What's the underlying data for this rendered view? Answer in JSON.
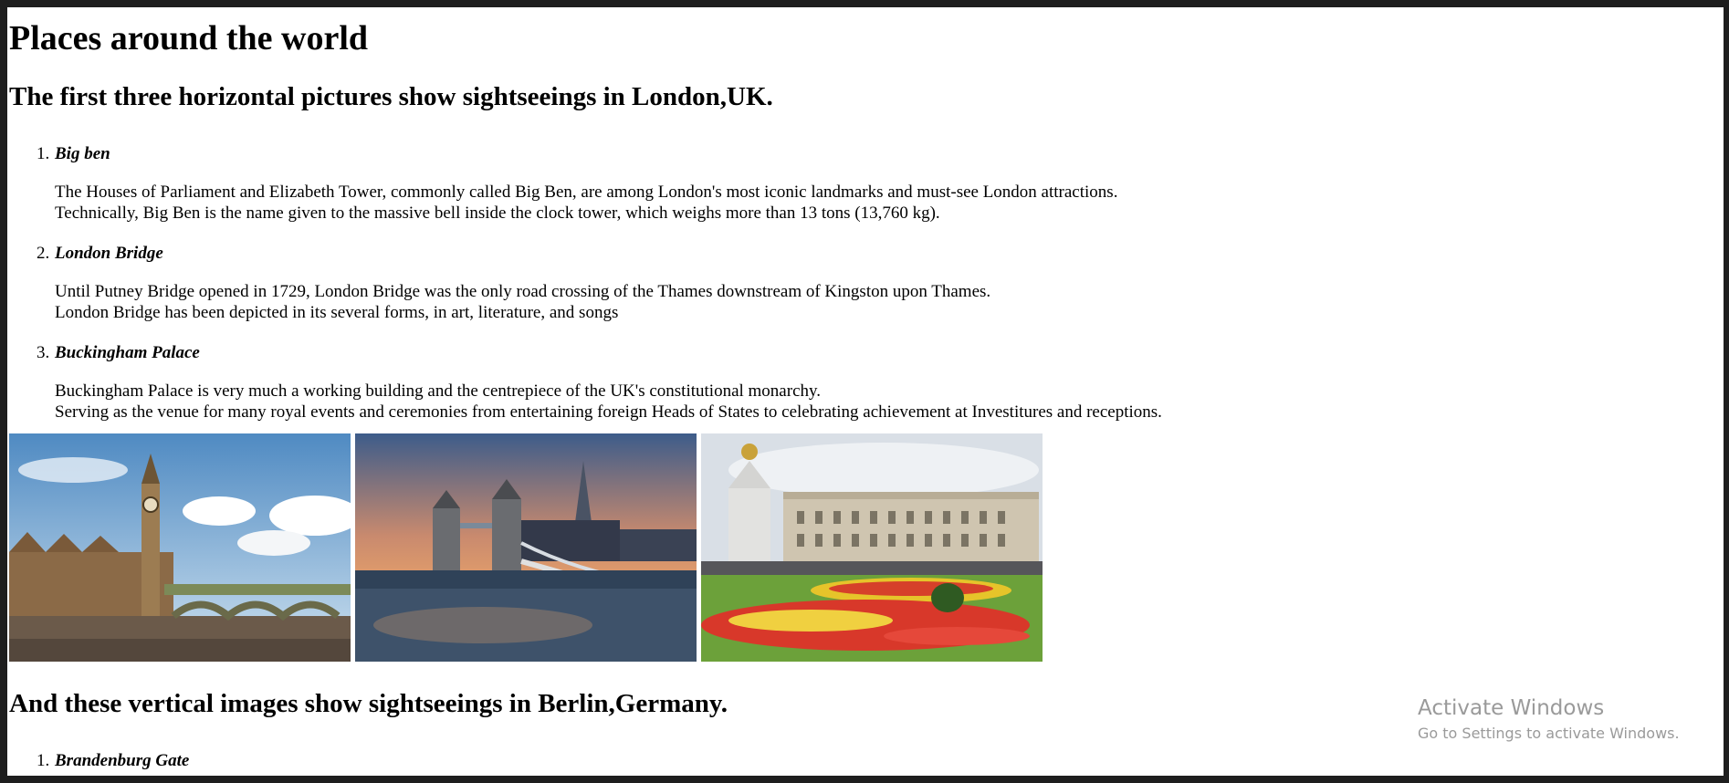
{
  "heading": "Places around the world",
  "london": {
    "heading": "The first three horizontal pictures show sightseeings in London,UK.",
    "items": [
      {
        "number": "1.",
        "title": "Big ben",
        "line1": "The Houses of Parliament and Elizabeth Tower, commonly called Big Ben, are among London's most iconic landmarks and must-see London attractions.",
        "line2": "Technically, Big Ben is the name given to the massive bell inside the clock tower, which weighs more than 13 tons (13,760 kg)."
      },
      {
        "number": "2.",
        "title": "London Bridge",
        "line1": "Until Putney Bridge opened in 1729, London Bridge was the only road crossing of the Thames downstream of Kingston upon Thames.",
        "line2": "London Bridge has been depicted in its several forms, in art, literature, and songs"
      },
      {
        "number": "3.",
        "title": "Buckingham Palace",
        "line1": "Buckingham Palace is very much a working building and the centrepiece of the UK's constitutional monarchy.",
        "line2": "Serving as the venue for many royal events and ceremonies from entertaining foreign Heads of States to celebrating achievement at Investitures and receptions."
      }
    ],
    "images": [
      "big-ben-photo",
      "tower-bridge-photo",
      "buckingham-palace-photo"
    ]
  },
  "berlin": {
    "heading": "And these vertical images show sightseeings in Berlin,Germany.",
    "items": [
      {
        "number": "1.",
        "title": "Brandenburg Gate"
      }
    ]
  },
  "watermark": {
    "title": "Activate Windows",
    "subtitle": "Go to Settings to activate Windows."
  }
}
